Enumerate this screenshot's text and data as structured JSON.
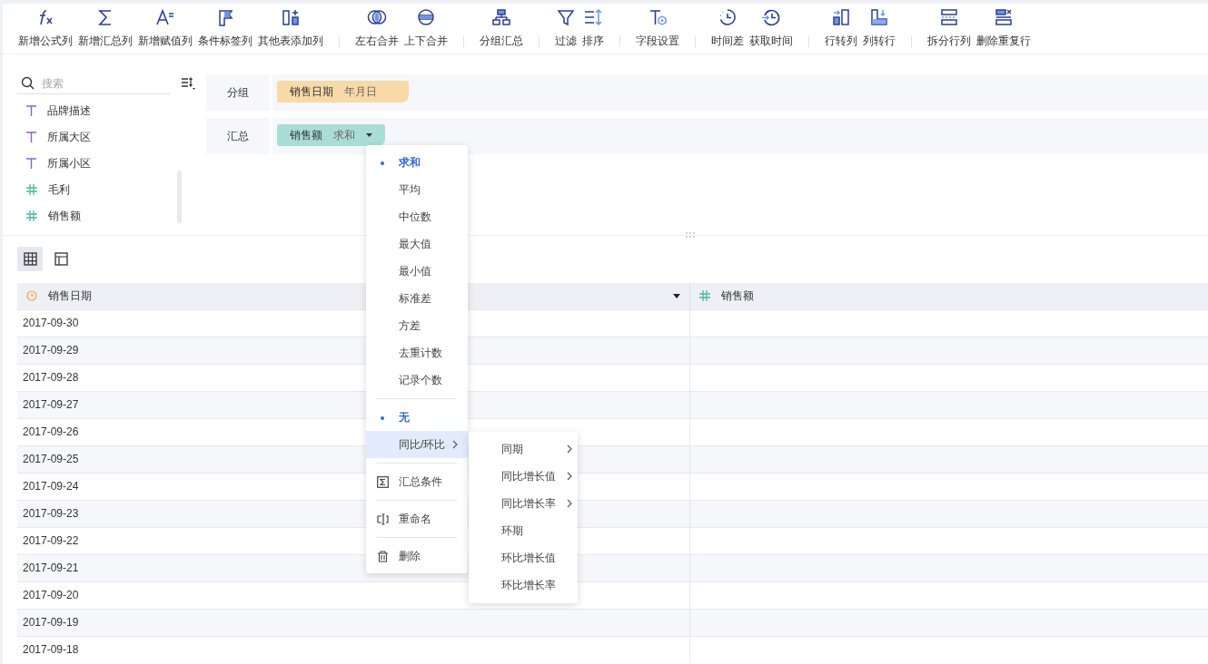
{
  "toolbar": {
    "groups": [
      [
        {
          "label": "新增公式列"
        },
        {
          "label": "新增汇总列"
        },
        {
          "label": "新增赋值列"
        },
        {
          "label": "条件标签列"
        },
        {
          "label": "其他表添加列"
        }
      ],
      [
        {
          "label": "左右合并"
        },
        {
          "label": "上下合并"
        }
      ],
      [
        {
          "label": "分组汇总"
        }
      ],
      [
        {
          "label": "过滤"
        },
        {
          "label": "排序"
        }
      ],
      [
        {
          "label": "字段设置"
        }
      ],
      [
        {
          "label": "时间差"
        },
        {
          "label": "获取时间"
        }
      ],
      [
        {
          "label": "行转列"
        },
        {
          "label": "列转行"
        }
      ],
      [
        {
          "label": "拆分行列"
        },
        {
          "label": "删除重复行"
        }
      ]
    ]
  },
  "field_panel": {
    "search": {
      "placeholder": "搜索"
    },
    "fields": [
      {
        "name": "品牌描述",
        "kind": "text"
      },
      {
        "name": "所属大区",
        "kind": "text"
      },
      {
        "name": "所属小区",
        "kind": "text"
      },
      {
        "name": "毛利",
        "kind": "number"
      },
      {
        "name": "销售额",
        "kind": "number"
      }
    ]
  },
  "config": [
    {
      "label": "分组",
      "chips": [
        {
          "name": "销售日期",
          "detail": "年月日",
          "kind": "dimension",
          "has_menu": false
        }
      ]
    },
    {
      "label": "汇总",
      "chips": [
        {
          "name": "销售额",
          "detail": "求和",
          "kind": "measure",
          "has_menu": true
        }
      ]
    }
  ],
  "view_toggles": [
    {
      "selected": true
    },
    {
      "selected": false
    }
  ],
  "table": {
    "columns": [
      {
        "name": "销售日期",
        "kind": "date",
        "has_menu": true
      },
      {
        "name": "销售额",
        "kind": "number",
        "has_menu": false
      }
    ],
    "rows": [
      "2017-09-30",
      "2017-09-29",
      "2017-09-28",
      "2017-09-27",
      "2017-09-26",
      "2017-09-25",
      "2017-09-24",
      "2017-09-23",
      "2017-09-22",
      "2017-09-21",
      "2017-09-20",
      "2017-09-19",
      "2017-09-18"
    ]
  },
  "menu": {
    "sections": [
      {
        "items": [
          {
            "label": "求和",
            "kind": "option",
            "selected": true
          },
          {
            "label": "平均",
            "kind": "option",
            "selected": false
          },
          {
            "label": "中位数",
            "kind": "option",
            "selected": false
          },
          {
            "label": "最大值",
            "kind": "option",
            "selected": false
          },
          {
            "label": "最小值",
            "kind": "option",
            "selected": false
          },
          {
            "label": "标准差",
            "kind": "option",
            "selected": false
          },
          {
            "label": "方差",
            "kind": "option",
            "selected": false
          },
          {
            "label": "去重计数",
            "kind": "option",
            "selected": false
          },
          {
            "label": "记录个数",
            "kind": "option",
            "selected": false
          }
        ]
      },
      {
        "items": [
          {
            "label": "无",
            "kind": "option",
            "selected": true
          },
          {
            "label": "同比/环比",
            "kind": "submenu",
            "selected": false,
            "expanded": true
          }
        ]
      },
      {
        "items": [
          {
            "label": "汇总条件",
            "kind": "action"
          }
        ]
      },
      {
        "items": [
          {
            "label": "重命名",
            "kind": "action"
          }
        ]
      },
      {
        "items": [
          {
            "label": "删除",
            "kind": "action"
          }
        ]
      }
    ],
    "submenu": [
      {
        "label": "同期",
        "has_children": true
      },
      {
        "label": "同比增长值",
        "has_children": true
      },
      {
        "label": "同比增长率",
        "has_children": true
      },
      {
        "label": "环期",
        "has_children": false
      },
      {
        "label": "环比增长值",
        "has_children": false
      },
      {
        "label": "环比增长率",
        "has_children": false
      }
    ]
  }
}
